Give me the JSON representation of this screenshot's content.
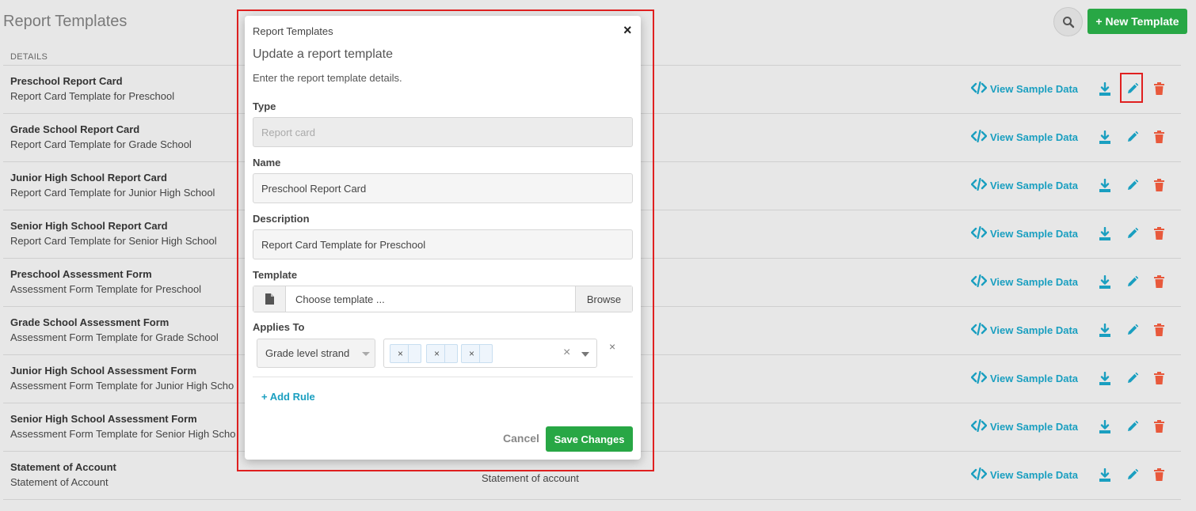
{
  "page": {
    "title": "Report Templates",
    "new_button_label": "+ New Template",
    "column_header": "DETAILS"
  },
  "rows": [
    {
      "name": "Preschool Report Card",
      "description": "Report Card Template for Preschool",
      "type": "",
      "view_label": "View Sample Data"
    },
    {
      "name": "Grade School Report Card",
      "description": "Report Card Template for Grade School",
      "type": "",
      "view_label": "View Sample Data"
    },
    {
      "name": "Junior High School Report Card",
      "description": "Report Card Template for Junior High School",
      "type": "",
      "view_label": "View Sample Data"
    },
    {
      "name": "Senior High School Report Card",
      "description": "Report Card Template for Senior High School",
      "type": "",
      "view_label": "View Sample Data"
    },
    {
      "name": "Preschool Assessment Form",
      "description": "Assessment Form Template for Preschool",
      "type": "",
      "view_label": "View Sample Data"
    },
    {
      "name": "Grade School Assessment Form",
      "description": "Assessment Form Template for Grade School",
      "type": "",
      "view_label": "View Sample Data"
    },
    {
      "name": "Junior High School Assessment Form",
      "description": "Assessment Form Template for Junior High Scho",
      "type": "",
      "view_label": "View Sample Data"
    },
    {
      "name": "Senior High School Assessment Form",
      "description": "Assessment Form Template for Senior High Scho",
      "type": "",
      "view_label": "View Sample Data"
    },
    {
      "name": "Statement of Account",
      "description": "Statement of Account",
      "type": "Statement of account",
      "view_label": "View Sample Data"
    }
  ],
  "modal": {
    "breadcrumb": "Report Templates",
    "close": "×",
    "title": "Update a report template",
    "subtitle": "Enter the report template details.",
    "type_label": "Type",
    "type_placeholder": "Report card",
    "name_label": "Name",
    "name_value": "Preschool Report Card",
    "description_label": "Description",
    "description_value": "Report Card Template for Preschool",
    "template_label": "Template",
    "template_placeholder": "Choose template ...",
    "browse_label": "Browse",
    "applies_to_label": "Applies To",
    "rule_field": "Grade level strand",
    "chip_remove": "×",
    "clear": "×",
    "rule_remove": "×",
    "add_rule_label": "+ Add Rule",
    "cancel_label": "Cancel",
    "save_label": "Save Changes"
  },
  "colors": {
    "accent_green": "#28a745",
    "link_blue": "#1a9fc0",
    "delete_red": "#e8593c",
    "highlight_red": "#e02020"
  }
}
